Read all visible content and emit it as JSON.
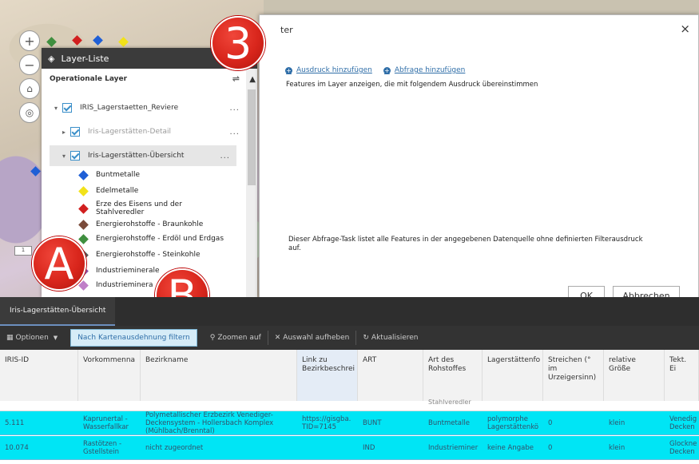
{
  "layer_list": {
    "title": "Layer-Liste",
    "section": "Operationale Layer",
    "layers": [
      {
        "label": "IRIS_Lagerstaetten_Reviere",
        "level": 0
      },
      {
        "label": "Iris-Lagerstätten-Detail",
        "level": 1
      },
      {
        "label": "Iris-Lagerstätten-Übersicht",
        "level": 1
      }
    ],
    "legend": [
      {
        "label": "Buntmetalle",
        "color": "#1f5fd6"
      },
      {
        "label": "Edelmetalle",
        "color": "#f2e21a"
      },
      {
        "label": "Erze des Eisens und der",
        "label2": "Stahlveredler",
        "color": "#d11f1f"
      },
      {
        "label": "Energierohstoffe - Braunkohle",
        "color": "#7a4b3a"
      },
      {
        "label": "Energierohstoffe - Erdöl und Erdgas",
        "color": "#3f8f3f"
      },
      {
        "label": "Energierohstoffe - Steinkohle",
        "color": "#555555"
      },
      {
        "label": "Industrieminerale",
        "color": "#8b4fa8"
      },
      {
        "label": "Industrieminera",
        "color": "#c07fc8"
      }
    ],
    "more": "..."
  },
  "map_controls": {
    "zoom_in": "+",
    "zoom_out": "−",
    "scale": "1"
  },
  "filter_dialog": {
    "title": "ter",
    "close": "×",
    "add_expression": "Ausdruck hinzufügen",
    "add_query": "Abfrage hinzufügen",
    "description": "Features im Layer anzeigen, die mit folgendem Ausdruck übereinstimmen",
    "note": "Dieser Abfrage-Task listet alle Features in der angegebenen Datenquelle ohne definierten Filterausdruck auf.",
    "ok": "OK",
    "cancel": "Abbrechen"
  },
  "badges": {
    "three": "3",
    "a": "A",
    "b": "B"
  },
  "attribute_table": {
    "tab": "Iris-Lagerstätten-Übersicht",
    "toolbar": {
      "options": "Optionen",
      "filter_extent": "Nach Kartenausdehnung filtern",
      "zoom": "Zoomen auf",
      "clear_selection": "Auswahl aufheben",
      "refresh": "Aktualisieren"
    },
    "columns": [
      "IRIS-ID",
      "Vorkommenna",
      "Bezirkname",
      "Link zu Bezirkbeschrei",
      "ART",
      "Art des Rohstoffes",
      "Lagerstättenfo",
      "Streichen (° im Urzeigersinn)",
      "relative Größe",
      "Tekt. Ei"
    ],
    "partial_row_text": "Stahlveredler",
    "rows": [
      [
        "5.111",
        "Kaprunertal - Wasserfallkar",
        "Polymetallischer Erzbezirk Venediger-Deckensystem - Hollersbach Komplex (Mühlbach/Brenntal)",
        "https://gisgba. TID=7145",
        "BUNT",
        "Buntmetalle",
        "polymorphe Lagerstättenkö",
        "0",
        "klein",
        "Venedig Decken"
      ],
      [
        "10.074",
        "Rastötzen - Gstellstein",
        "nicht zugeordnet",
        "",
        "IND",
        "Industrieminer",
        "keine Angabe",
        "0",
        "klein",
        "Glockne Decken"
      ]
    ]
  }
}
